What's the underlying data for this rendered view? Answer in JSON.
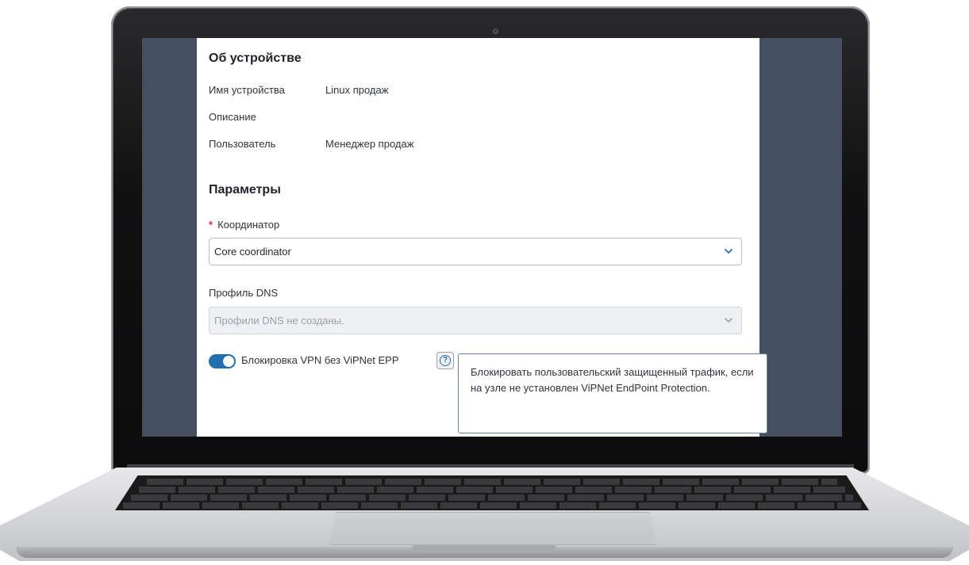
{
  "device_section": {
    "title": "Об устройстве",
    "fields": [
      {
        "label": "Имя устройства",
        "value": "Linux продаж"
      },
      {
        "label": "Описание",
        "value": ""
      },
      {
        "label": "Пользователь",
        "value": "Менеджер продаж"
      }
    ]
  },
  "params_section": {
    "title": "Параметры",
    "coordinator": {
      "required_mark": "*",
      "label": "Координатор",
      "value": "Core coordinator",
      "icon": "chevron-down-icon"
    },
    "dns_profile": {
      "label": "Профиль DNS",
      "placeholder": "Профили DNS не созданы.",
      "disabled": true,
      "icon": "chevron-down-icon"
    },
    "vpn_block": {
      "label": "Блокировка VPN без ViPNet EPP",
      "enabled": true,
      "help_icon": "question-circle-icon",
      "help_glyph": "?",
      "tooltip": "Блокировать пользовательский защищенный трафик, если на узле не установлен ViPNet EndPoint Protection."
    }
  },
  "colors": {
    "accent": "#1f6fb2",
    "screen_background": "#44505f",
    "required": "#e0303a"
  }
}
